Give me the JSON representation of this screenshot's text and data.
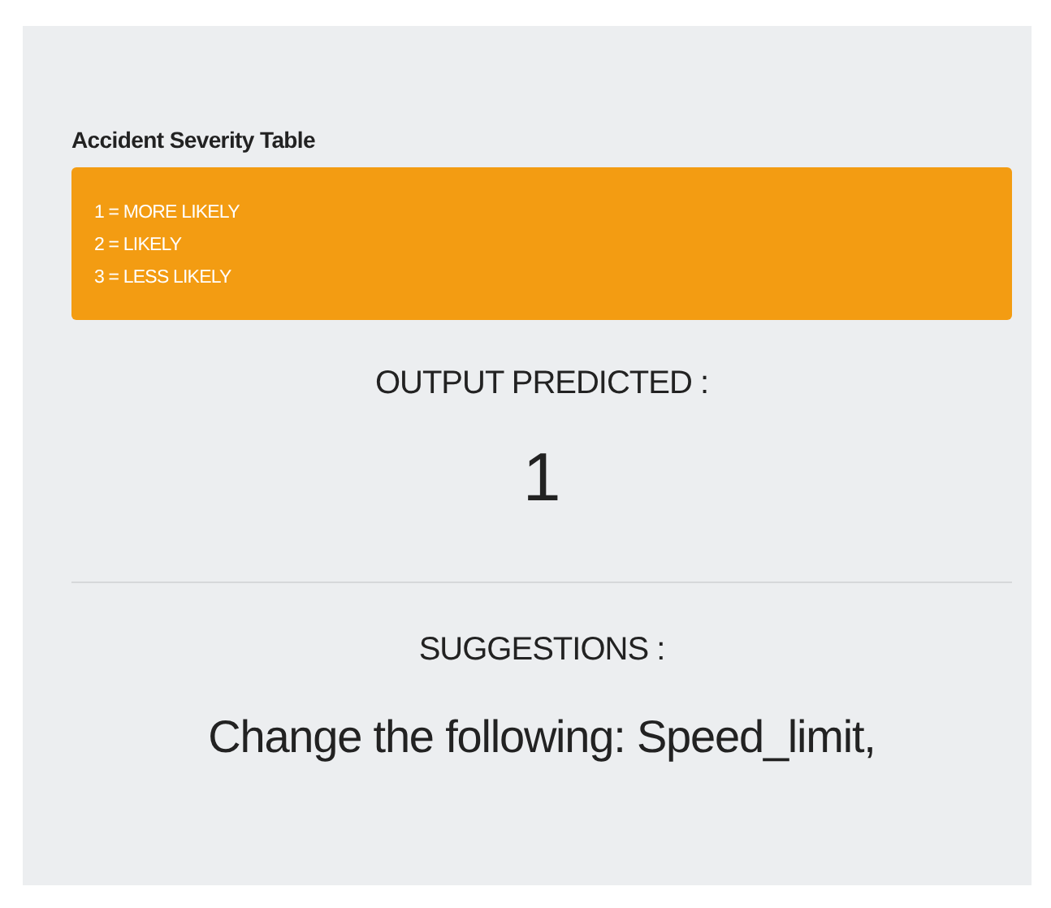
{
  "table": {
    "title": "Accident Severity Table",
    "lines": [
      "1 = MORE LIKELY",
      "2 = LIKELY",
      "3 = LESS LIKELY"
    ]
  },
  "output": {
    "label": "OUTPUT PREDICTED :",
    "value": "1"
  },
  "suggestions": {
    "label": "SUGGESTIONS :",
    "text": "Change the following: Speed_limit,"
  }
}
